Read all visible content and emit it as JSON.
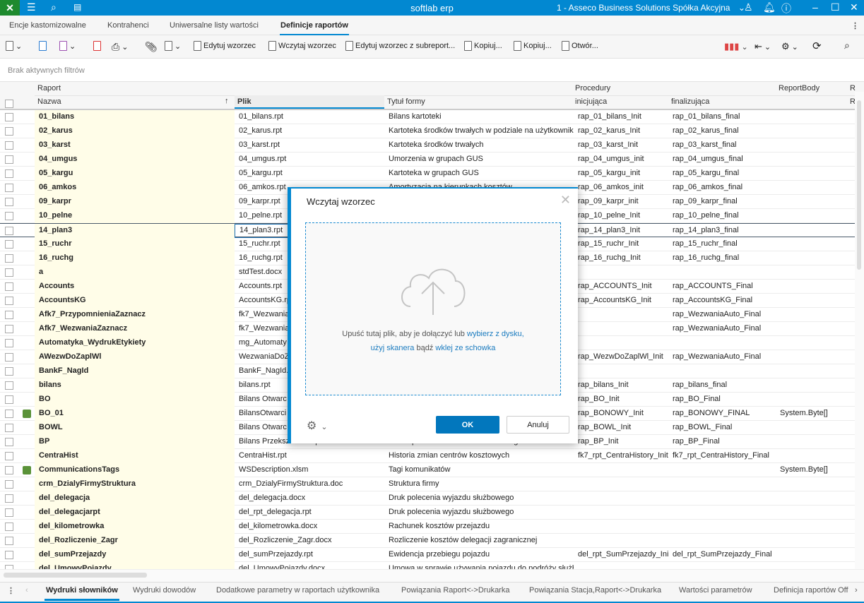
{
  "titlebar": {
    "app_title": "softlab erp",
    "company": "1 - Asseco Business Solutions Spółka Akcyjna",
    "icons": [
      "tools-icon",
      "menu-icon",
      "search-icon",
      "news-icon",
      "user-icon",
      "bell-icon",
      "help-icon",
      "minimize-icon",
      "maximize-icon",
      "close-icon"
    ]
  },
  "tabs": [
    {
      "label": "Encje kastomizowalne"
    },
    {
      "label": "Kontrahenci"
    },
    {
      "label": "Uniwersalne listy wartości"
    },
    {
      "label": "Definicje raportów",
      "active": true
    }
  ],
  "toolbar": {
    "edit_template": "Edytuj wzorzec",
    "load_template": "Wczytaj wzorzec",
    "edit_subreport": "Edytuj wzorzec z subreport...",
    "copy1": "Kopiuj...",
    "copy2": "Kopiuj...",
    "open": "Otwór..."
  },
  "filter": {
    "text": "Brak aktywnych filtrów"
  },
  "header": {
    "group_raport": "Raport",
    "group_procedury": "Procedury",
    "reportbody": "ReportBody",
    "nazwa": "Nazwa",
    "plik": "Plik",
    "tytul": "Tytuł formy",
    "inicjujaca": "inicjująca",
    "finalizujaca": "finalizująca",
    "extra1": "R",
    "extra2": "R"
  },
  "rows": [
    [
      "01_bilans",
      "01_bilans.rpt",
      "Bilans kartoteki",
      "rap_01_bilans_Init",
      "rap_01_bilans_final",
      "",
      false
    ],
    [
      "02_karus",
      "02_karus.rpt",
      "Kartoteka środków trwałych w podziale na użytkowników",
      "rap_02_karus_Init",
      "rap_02_karus_final",
      "",
      false
    ],
    [
      "03_karst",
      "03_karst.rpt",
      "Kartoteka środków trwałych",
      "rap_03_karst_Init",
      "rap_03_karst_final",
      "",
      false
    ],
    [
      "04_umgus",
      "04_umgus.rpt",
      "Umorzenia w grupach GUS",
      "rap_04_umgus_init",
      "rap_04_umgus_final",
      "",
      false
    ],
    [
      "05_kargu",
      "05_kargu.rpt",
      "Kartoteka w grupach GUS",
      "rap_05_kargu_init",
      "rap_05_kargu_final",
      "",
      false
    ],
    [
      "06_amkos",
      "06_amkos.rpt",
      "Amortyzacja na kierunkach kosztów",
      "rap_06_amkos_init",
      "rap_06_amkos_final",
      "",
      false
    ],
    [
      "09_karpr",
      "09_karpr.rpt",
      "",
      "rap_09_karpr_init",
      "rap_09_karpr_final",
      "",
      false
    ],
    [
      "10_pelne",
      "10_pelne.rpt",
      "",
      "rap_10_pelne_Init",
      "rap_10_pelne_final",
      "",
      false
    ],
    [
      "14_plan3",
      "14_plan3.rpt",
      "",
      "rap_14_plan3_Init",
      "rap_14_plan3_final",
      "",
      false
    ],
    [
      "15_ruchr",
      "15_ruchr.rpt",
      "",
      "rap_15_ruchr_Init",
      "rap_15_ruchr_final",
      "",
      false
    ],
    [
      "16_ruchg",
      "16_ruchg.rpt",
      "",
      "rap_16_ruchg_Init",
      "rap_16_ruchg_final",
      "",
      false
    ],
    [
      "a",
      "stdTest.docx",
      "",
      "",
      "",
      "",
      false
    ],
    [
      "Accounts",
      "Accounts.rpt",
      "",
      "rap_ACCOUNTS_Init",
      "rap_ACCOUNTS_Final",
      "",
      false
    ],
    [
      "AccountsKG",
      "AccountsKG.rpt",
      "",
      "rap_AccountsKG_Init",
      "rap_AccountsKG_Final",
      "",
      false
    ],
    [
      "Afk7_PrzypomnieniaZaznacz",
      "fk7_Wezwania",
      "",
      "",
      "rap_WezwaniaAuto_Final",
      "",
      false
    ],
    [
      "Afk7_WezwaniaZaznacz",
      "fk7_Wezwania",
      "",
      "",
      "rap_WezwaniaAuto_Final",
      "",
      false
    ],
    [
      "Automatyka_WydrukEtykiety",
      "mg_Automaty",
      "",
      "",
      "",
      "",
      false
    ],
    [
      "AWezwDoZaplWl",
      "WezwaniaDoZ",
      "",
      "rap_WezwDoZaplWl_Init",
      "rap_WezwaniaAuto_Final",
      "",
      false
    ],
    [
      "BankF_NagId",
      "BankF_NagId.",
      "",
      "",
      "",
      "",
      false
    ],
    [
      "bilans",
      "bilans.rpt",
      "",
      "rap_bilans_Init",
      "rap_bilans_final",
      "",
      false
    ],
    [
      "BO",
      "Bilans Otwarc",
      "",
      "rap_BO_Init",
      "rap_BO_Final",
      "",
      false
    ],
    [
      "BO_01",
      "BilansOtwarci",
      "",
      "rap_BONOWY_Init",
      "rap_BONOWY_FINAL",
      "System.Byte[]",
      true
    ],
    [
      "BOWL",
      "Bilans Otwarc",
      "",
      "rap_BOWL_Init",
      "rap_BOWL_Final",
      "",
      false
    ],
    [
      "BP",
      "Bilans Przekształceń.rpt",
      "Bilans przekształceń roku finansowego",
      "rap_BP_Init",
      "rap_BP_Final",
      "",
      false
    ],
    [
      "CentraHist",
      "CentraHist.rpt",
      "Historia zmian centrów kosztowych",
      "fk7_rpt_CentraHistory_Init",
      "fk7_rpt_CentraHistory_Final",
      "",
      false
    ],
    [
      "CommunicationsTags",
      "WSDescription.xlsm",
      "Tagi komunikatów",
      "",
      "",
      "System.Byte[]",
      true
    ],
    [
      "crm_DzialyFirmyStruktura",
      "crm_DzialyFirmyStruktura.doc",
      "Struktura firmy",
      "",
      "",
      "",
      false
    ],
    [
      "del_delegacja",
      "del_delegacja.docx",
      "Druk polecenia wyjazdu służbowego",
      "",
      "",
      "",
      false
    ],
    [
      "del_delegacjarpt",
      "del_rpt_delegacja.rpt",
      "Druk polecenia wyjazdu służbowego",
      "",
      "",
      "",
      false
    ],
    [
      "del_kilometrowka",
      "del_kilometrowka.docx",
      "Rachunek kosztów przejazdu",
      "",
      "",
      "",
      false
    ],
    [
      "del_Rozliczenie_Zagr",
      "del_Rozliczenie_Zagr.docx",
      "Rozliczenie kosztów delegacji zagranicznej",
      "",
      "",
      "",
      false
    ],
    [
      "del_sumPrzejazdy",
      "del_sumPrzejazdy.rpt",
      "Ewidencja przebiegu pojazdu",
      "del_rpt_SumPrzejazdy_Init",
      "del_rpt_SumPrzejazdy_Final",
      "",
      false
    ],
    [
      "del_UmowyPojazdy",
      "del_UmowyPojazdy.docx",
      "Umowa w sprawie używania pojazdu do podróży służbowych",
      "",
      "",
      "",
      false
    ]
  ],
  "selected_row": 8,
  "bottom_tabs": [
    {
      "label": "Wydruki słowników",
      "active": true
    },
    {
      "label": "Wydruki dowodów"
    },
    {
      "label": "Dodatkowe parametry w raportach użytkownika"
    },
    {
      "label": "Powiązania Raport<->Drukarka"
    },
    {
      "label": "Powiązania Stacja,Raport<->Drukarka"
    },
    {
      "label": "Wartości parametrów"
    },
    {
      "label": "Definicja raportów Off"
    }
  ],
  "modal": {
    "title": "Wczytaj wzorzec",
    "drop_text": "Upuść tutaj plik, aby je dołączyć lub",
    "link_disk": "wybierz z dysku,",
    "link_scanner": "użyj skanera",
    "or_text": "bądź",
    "link_clipboard": "wklej ze schowka",
    "ok": "OK",
    "cancel": "Anuluj"
  },
  "colors": {
    "accent": "#0288d1",
    "name_column_bg": "#fffde8",
    "tag_green": "#5a9238",
    "ok_button": "#0277bd"
  }
}
